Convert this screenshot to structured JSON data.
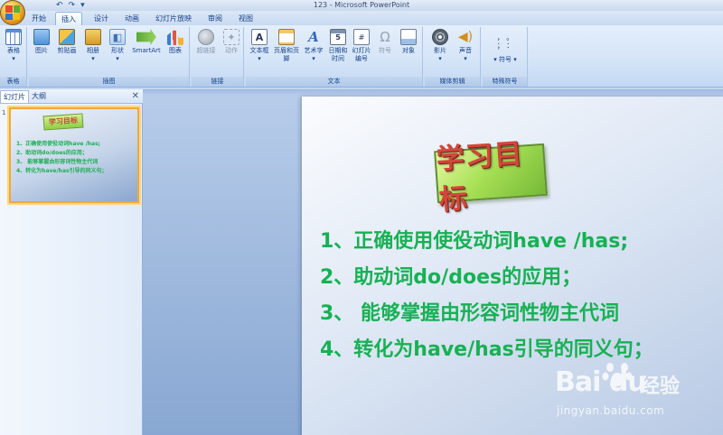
{
  "window": {
    "title": "123 - Microsoft PowerPoint"
  },
  "quick_access": {
    "undo_glyph": "↶",
    "redo_glyph": "↷",
    "customize_glyph": "▾"
  },
  "tabs": [
    "开始",
    "插入",
    "设计",
    "动画",
    "幻灯片放映",
    "审阅",
    "视图"
  ],
  "active_tab": "插入",
  "ribbon": {
    "groups": [
      {
        "label": "表格",
        "buttons": [
          {
            "label": "表格",
            "icon": "table-icon"
          }
        ]
      },
      {
        "label": "插图",
        "buttons": [
          {
            "label": "图片",
            "icon": "picture-icon"
          },
          {
            "label": "剪贴画",
            "icon": "clipart-icon"
          },
          {
            "label": "相册",
            "icon": "photo-album-icon"
          },
          {
            "label": "形状",
            "icon": "shapes-icon"
          },
          {
            "label": "SmartArt",
            "icon": "smartart-icon"
          },
          {
            "label": "图表",
            "icon": "chart-icon"
          }
        ]
      },
      {
        "label": "链接",
        "buttons": [
          {
            "label": "超链接",
            "icon": "hyperlink-icon",
            "disabled": true
          },
          {
            "label": "动作",
            "icon": "action-icon",
            "disabled": true
          }
        ]
      },
      {
        "label": "文本",
        "buttons": [
          {
            "label": "文本框",
            "icon": "textbox-icon"
          },
          {
            "label": "页眉和页脚",
            "icon": "header-footer-icon"
          },
          {
            "label": "艺术字",
            "icon": "wordart-icon"
          },
          {
            "label": "日期和时间",
            "icon": "date-time-icon"
          },
          {
            "label": "幻灯片编号",
            "icon": "slide-number-icon"
          },
          {
            "label": "符号",
            "icon": "symbol-icon",
            "disabled": true
          },
          {
            "label": "对象",
            "icon": "object-icon"
          }
        ]
      },
      {
        "label": "媒体剪辑",
        "buttons": [
          {
            "label": "影片",
            "icon": "movie-icon"
          },
          {
            "label": "声音",
            "icon": "sound-icon"
          }
        ]
      },
      {
        "label": "特殊符号",
        "buttons": [
          {
            "label": "符号",
            "icon": "special-symbol-icon"
          }
        ]
      }
    ]
  },
  "slides_panel": {
    "tabs": [
      "幻灯片",
      "大纲"
    ],
    "active_tab": "幻灯片",
    "close_glyph": "✕",
    "thumbnails": [
      {
        "number": "1"
      }
    ]
  },
  "slide": {
    "title": "学习目标",
    "objectives": [
      "1、正确使用使役动词have /has;",
      "2、助动词do/does的应用；",
      "3、 能够掌握由形容词性物主代词",
      "4、转化为have/has引导的同义句；"
    ]
  },
  "watermark": {
    "logo": "Bai du",
    "cn": "经验",
    "url": "jingyan.baidu.com"
  },
  "colors": {
    "ribbon_text": "#15428b",
    "objective_green": "#17b154",
    "title_red": "#d2473a",
    "title_box_green": "#a9e157",
    "thumb_selected": "#f1a83a"
  }
}
